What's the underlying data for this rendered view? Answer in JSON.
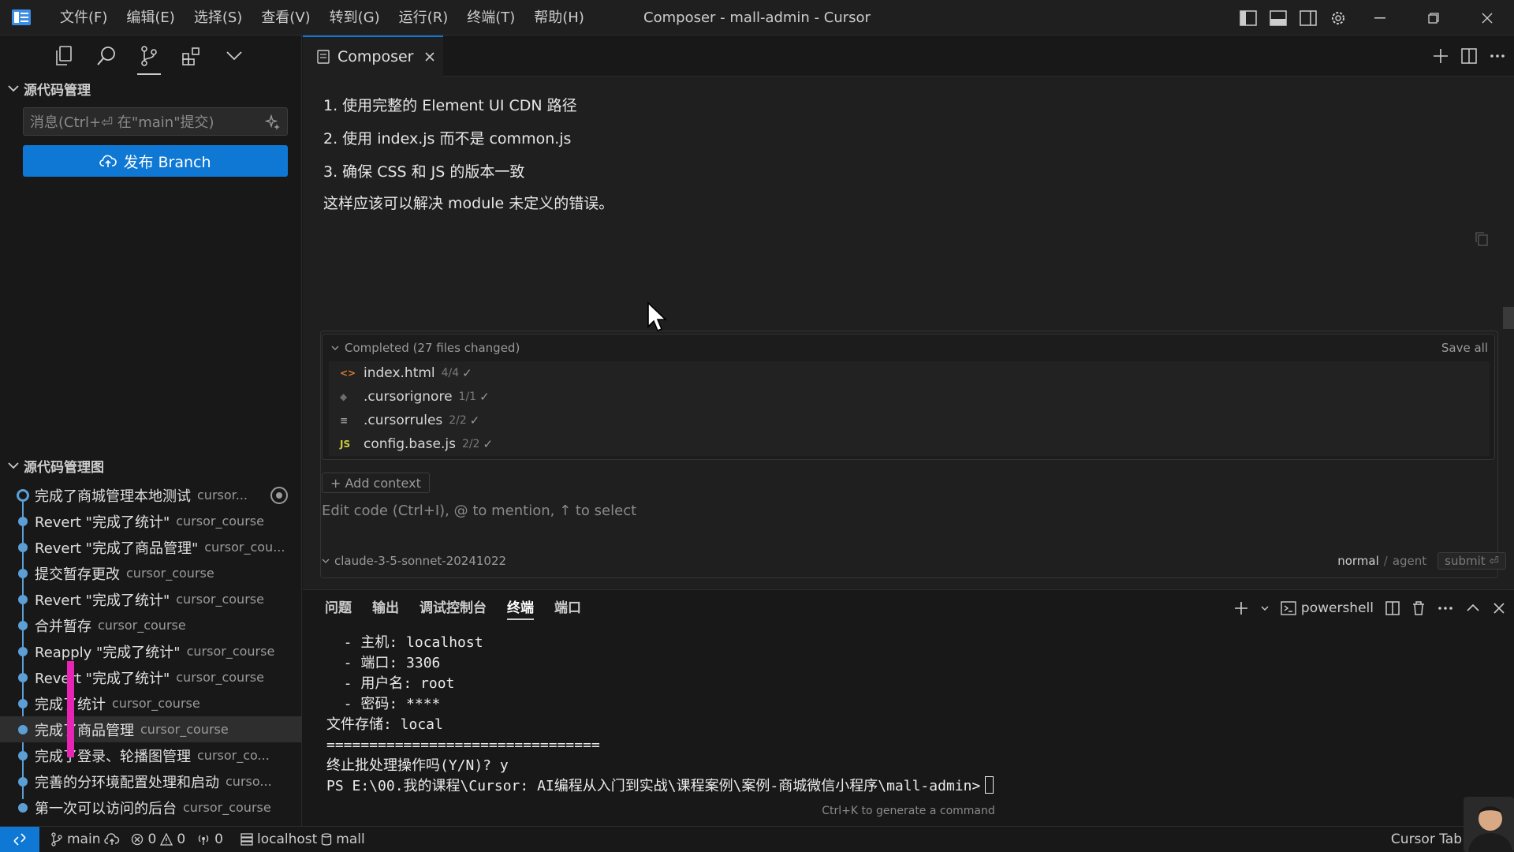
{
  "window": {
    "title": "Composer - mall-admin - Cursor",
    "menu": [
      "文件(F)",
      "编辑(E)",
      "选择(S)",
      "查看(V)",
      "转到(G)",
      "运行(R)",
      "终端(T)",
      "帮助(H)"
    ]
  },
  "colors": {
    "accent": "#0e78d4",
    "graph": "#5b9fd6",
    "marker": "#e824b4"
  },
  "sidebar": {
    "scm_title": "源代码管理",
    "commit_placeholder": "消息(Ctrl+⏎ 在\"main\"提交)",
    "publish_label": "发布 Branch",
    "graph_title": "源代码管理图",
    "graph_items": [
      {
        "message": "完成了商城管理本地测试",
        "author": "cursor..."
      },
      {
        "message": "Revert \"完成了统计\"",
        "author": "cursor_course"
      },
      {
        "message": "Revert \"完成了商品管理\"",
        "author": "cursor_cou..."
      },
      {
        "message": "提交暂存更改",
        "author": "cursor_course"
      },
      {
        "message": "Revert \"完成了统计\"",
        "author": "cursor_course"
      },
      {
        "message": "合并暂存",
        "author": "cursor_course"
      },
      {
        "message": "Reapply \"完成了统计\"",
        "author": "cursor_course"
      },
      {
        "message": "Revert \"完成了统计\"",
        "author": "cursor_course"
      },
      {
        "message": "完成了统计",
        "author": "cursor_course"
      },
      {
        "message": "完成了商品管理",
        "author": "cursor_course"
      },
      {
        "message": "完成了登录、轮播图管理",
        "author": "cursor_co..."
      },
      {
        "message": "完善的分环境配置处理和启动",
        "author": "curso..."
      },
      {
        "message": "第一次可以访问的后台",
        "author": "cursor_course"
      }
    ]
  },
  "editor": {
    "tab_label": "Composer",
    "answer_lines": [
      "1. 使用完整的 Element UI CDN 路径",
      "2. 使用 index.js 而不是 common.js",
      "3. 确保 CSS 和 JS 的版本一致",
      "这样应该可以解决 module 未定义的错误。"
    ],
    "changes_header": "Completed (27 files changed)",
    "save_all": "Save all",
    "files": [
      {
        "icon": "<>",
        "icon_color": "#e37933",
        "name": "index.html",
        "count": "4/4",
        "check": "✓"
      },
      {
        "icon": "◆",
        "icon_color": "#6d6d6d",
        "name": ".cursorignore",
        "count": "1/1",
        "check": "✓"
      },
      {
        "icon": "≡",
        "icon_color": "#9a9a9a",
        "name": ".cursorrules",
        "count": "2/2",
        "check": "✓"
      },
      {
        "icon": "JS",
        "icon_color": "#cbcb41",
        "name": "config.base.js",
        "count": "2/2",
        "check": "✓"
      }
    ],
    "add_context": "+ Add context",
    "input_placeholder": "Edit code (Ctrl+I), @ to mention, ↑ to select",
    "model": "claude-3-5-sonnet-20241022",
    "mode_normal": "normal",
    "mode_sep": "/",
    "mode_agent": "agent",
    "submit": "submit ⏎"
  },
  "panel": {
    "tabs": [
      "问题",
      "输出",
      "调试控制台",
      "终端",
      "端口"
    ],
    "shell": "powershell",
    "terminal_lines": [
      "  - 主机: localhost",
      "  - 端口: 3306",
      "  - 用户名: root",
      "  - 密码: ****",
      "文件存储: local",
      "================================",
      "终止批处理操作吗(Y/N)? y",
      "PS E:\\00.我的课程\\Cursor: AI编程从入门到实战\\课程案例\\案例-商城微信小程序\\mall-admin>"
    ],
    "hint": "Ctrl+K to generate a command"
  },
  "statusbar": {
    "branch": "main",
    "errors": "0",
    "warnings": "0",
    "ports": "0",
    "db_host": "localhost",
    "db_name": "mall",
    "cursor_tab": "Cursor Tab"
  }
}
